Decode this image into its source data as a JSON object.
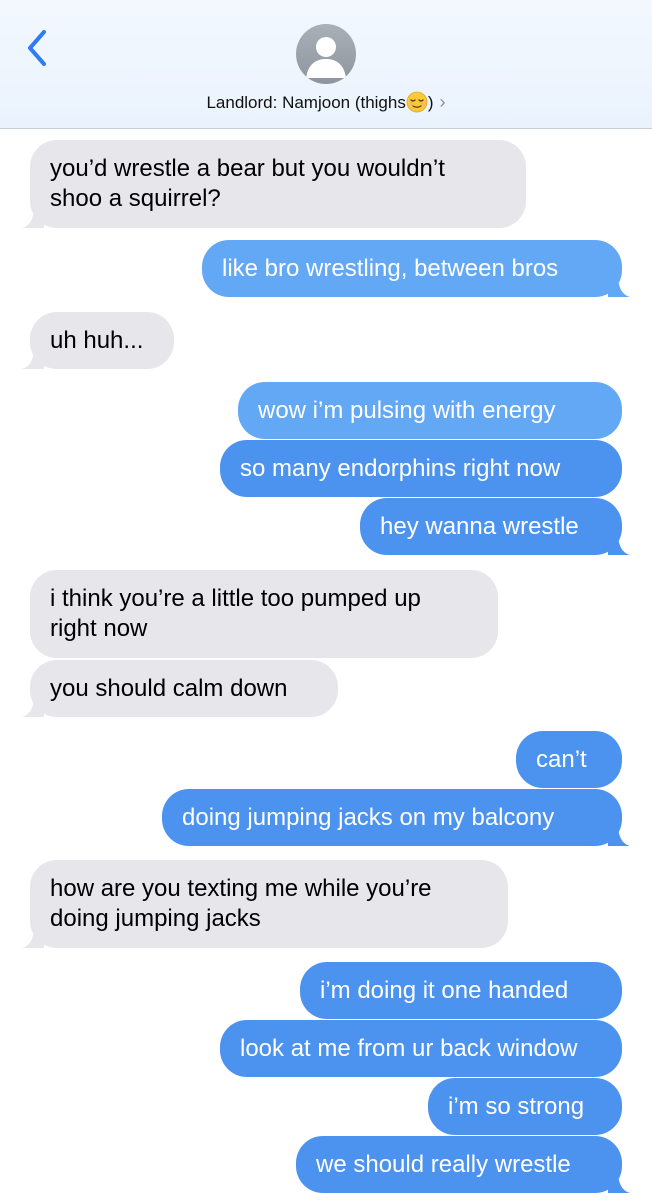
{
  "header": {
    "contact_name": "Landlord: Namjoon (thighs",
    "contact_suffix": ")",
    "chevron": "›"
  },
  "icons": {
    "back": "chevron-left-icon",
    "avatar": "person-silhouette-icon",
    "emoji": "relieved-face-emoji"
  },
  "colors": {
    "outgoing": "#4c92ef",
    "outgoing_light": "#62a8f5",
    "incoming": "#e6e6eb",
    "accent": "#2f7cf6"
  },
  "messages": [
    {
      "dir": "in",
      "text": "you’d wrestle a bear but you wouldn’t\nshoo a squirrel?"
    },
    {
      "dir": "out",
      "text": "like bro wrestling, between bros"
    },
    {
      "dir": "in",
      "text": "uh huh..."
    },
    {
      "dir": "out",
      "text": "wow i’m pulsing with energy"
    },
    {
      "dir": "out",
      "text": "so many endorphins right now"
    },
    {
      "dir": "out",
      "text": "hey wanna wrestle"
    },
    {
      "dir": "in",
      "text": "i think you’re a little too pumped up\nright now"
    },
    {
      "dir": "in",
      "text": "you should calm down"
    },
    {
      "dir": "out",
      "text": "can’t"
    },
    {
      "dir": "out",
      "text": "doing jumping jacks on my balcony"
    },
    {
      "dir": "in",
      "text": "how are you texting me while you’re\ndoing jumping jacks"
    },
    {
      "dir": "out",
      "text": "i’m doing it one handed"
    },
    {
      "dir": "out",
      "text": "look at me from ur back window"
    },
    {
      "dir": "out",
      "text": "i’m so strong"
    },
    {
      "dir": "out",
      "text": "we should really wrestle"
    }
  ]
}
